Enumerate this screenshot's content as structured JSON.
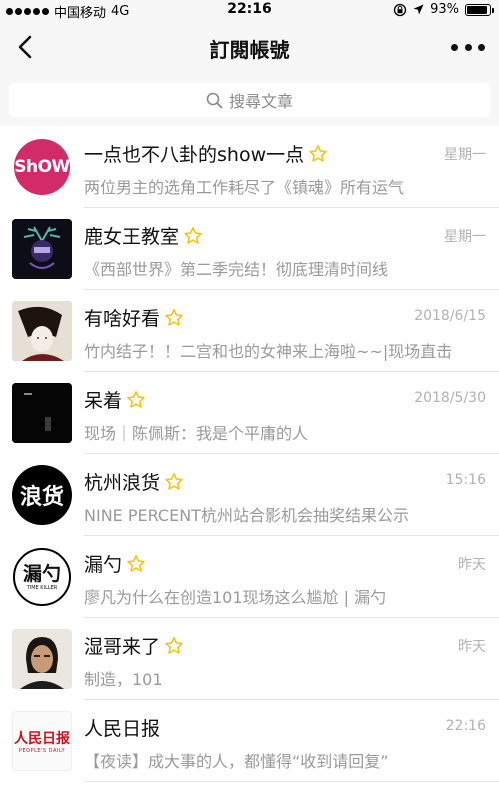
{
  "status_bar": {
    "carrier": "中国移动",
    "network": "4G",
    "time": "22:16",
    "battery": "93%",
    "battery_level": 0.93
  },
  "nav": {
    "title": "訂閱帳號",
    "back_icon": "chevron-left-icon",
    "more_icon": "more-dots-icon"
  },
  "search": {
    "placeholder": "搜尋文章"
  },
  "colors": {
    "star": "#f5c400",
    "bar_bg": "#f7f7f7",
    "secondary_text": "#9a9a9a"
  },
  "accounts": [
    {
      "name": "一点也不八卦的show一点",
      "starred": true,
      "date": "星期一",
      "preview": "两位男主的选角工作耗尽了《镇魂》所有运气",
      "avatar_text": "ShOW"
    },
    {
      "name": "鹿女王教室",
      "starred": true,
      "date": "星期一",
      "preview": "《西部世界》第二季完结！彻底理清时间线"
    },
    {
      "name": "有啥好看",
      "starred": true,
      "date": "2018/6/15",
      "preview": "竹内结子！！二宫和也的女神来上海啦~~|现场直击"
    },
    {
      "name": "呆着",
      "starred": true,
      "date": "2018/5/30",
      "preview": "现场｜陈佩斯：我是个平庸的人"
    },
    {
      "name": "杭州浪货",
      "starred": true,
      "date": "15:16",
      "preview": "NINE PERCENT杭州站合影机会抽奖结果公示",
      "avatar_text": "浪货"
    },
    {
      "name": "漏勺",
      "starred": true,
      "date": "昨天",
      "preview": "廖凡为什么在创造101现场这么尴尬 | 漏勺",
      "avatar_text": "漏勺",
      "avatar_sub": "TIME KILLER"
    },
    {
      "name": "湿哥来了",
      "starred": true,
      "date": "昨天",
      "preview": "制造，101"
    },
    {
      "name": "人民日报",
      "starred": false,
      "date": "22:16",
      "preview": "【夜读】成大事的人，都懂得“收到请回复”",
      "avatar_text": "人民日报",
      "avatar_sub": "PEOPLE'S DAILY"
    }
  ]
}
